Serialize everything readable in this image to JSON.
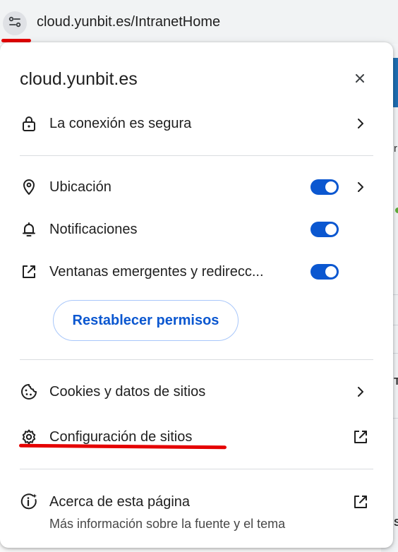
{
  "address_bar": {
    "url": "cloud.yunbit.es/IntranetHome",
    "site_info_icon": "tune-icon"
  },
  "background_page": {
    "fragments": [
      "r",
      "T",
      "S"
    ]
  },
  "popup": {
    "title": "cloud.yunbit.es",
    "connection": {
      "label": "La conexión es segura",
      "icon": "lock-icon"
    },
    "permissions": [
      {
        "label": "Ubicación",
        "icon": "location-pin-icon",
        "enabled": true,
        "has_chevron": true
      },
      {
        "label": "Notificaciones",
        "icon": "bell-icon",
        "enabled": true,
        "has_chevron": false
      },
      {
        "label": "Ventanas emergentes y redirecc...",
        "icon": "open-in-new-icon",
        "enabled": true,
        "has_chevron": false
      }
    ],
    "reset_button_label": "Restablecer permisos",
    "cookies": {
      "label": "Cookies y datos de sitios",
      "icon": "cookie-icon"
    },
    "site_settings": {
      "label": "Configuración de sitios",
      "icon": "gear-icon"
    },
    "about": {
      "label": "Acerca de esta página",
      "sublabel": "Más información sobre la fuente y el tema",
      "icon": "page-info-icon"
    }
  },
  "colors": {
    "accent": "#0b57d0",
    "annotation_red": "#e50000",
    "toolbar_bg": "#f1f3f4"
  }
}
